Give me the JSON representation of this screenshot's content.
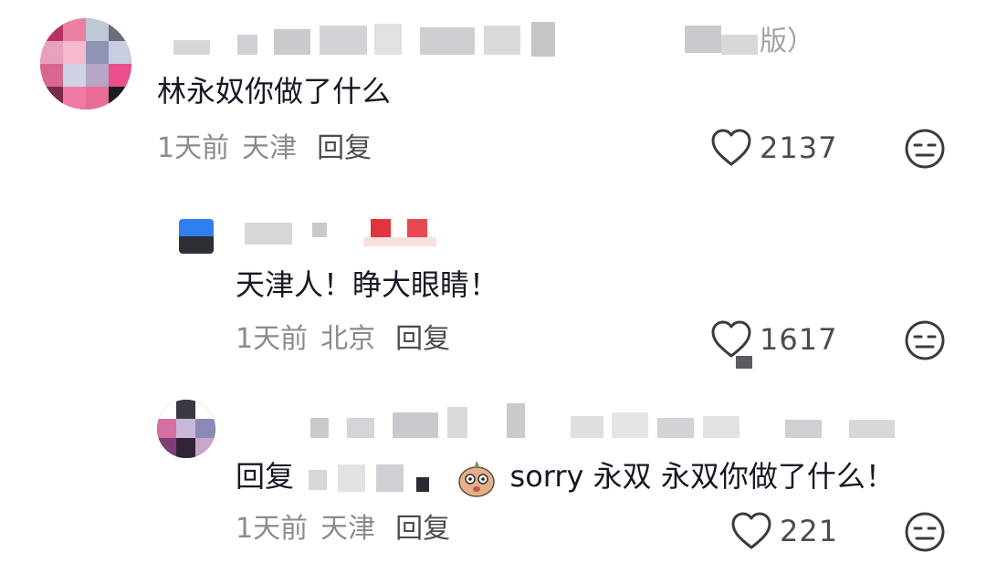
{
  "comments": [
    {
      "text": "林永奴你做了什么",
      "time": "1天前",
      "location": "天津",
      "reply_label": "回复",
      "likes": "2137",
      "username_suffix": "版）"
    },
    {
      "text": "天津人！睁大眼睛！",
      "time": "1天前",
      "location": "北京",
      "reply_label": "回复",
      "likes": "1617"
    },
    {
      "reply_prefix": "回复",
      "text": "sorry 永双  永双你做了什么！",
      "time": "1天前",
      "location": "天津",
      "reply_label": "回复",
      "likes": "221"
    }
  ],
  "icons": {
    "like": "heart-outline-icon",
    "dislike": "neutral-face-icon"
  },
  "colors": {
    "text": "#161823",
    "meta": "#8a8b91",
    "reply": "#4b4c52"
  }
}
